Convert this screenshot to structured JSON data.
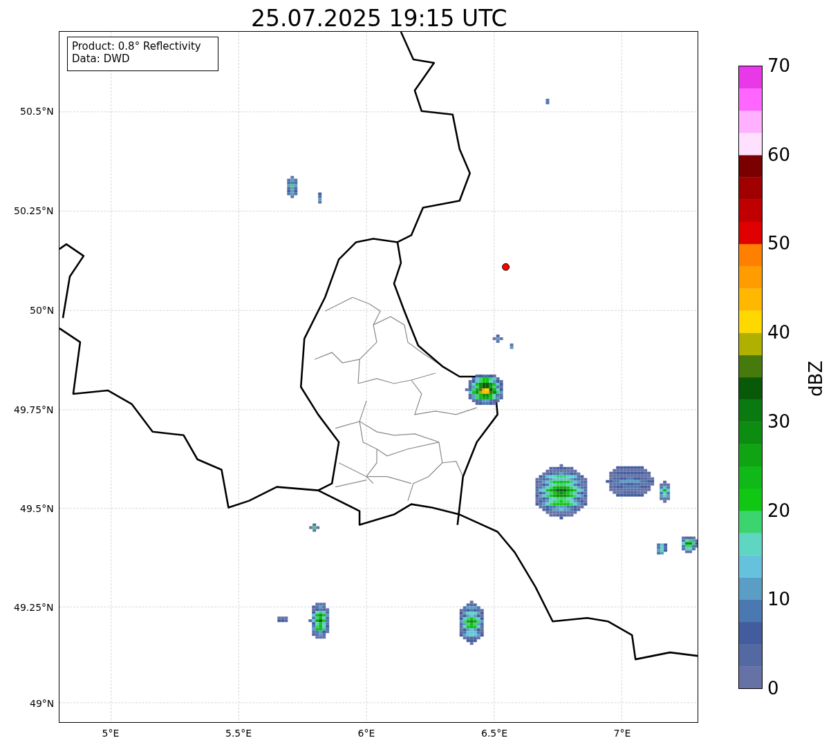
{
  "title": "25.07.2025 19:15 UTC",
  "info_box": [
    "Product: 0.8° Reflectivity",
    "Data: DWD"
  ],
  "map": {
    "y_ticks": [
      "50.5°N",
      "50.25°N",
      "50°N",
      "49.75°N",
      "49.5°N",
      "49.25°N",
      "49°N"
    ],
    "x_ticks": [
      "5°E",
      "5.5°E",
      "6°E",
      "6.5°E",
      "7°E"
    ]
  },
  "colorbar": {
    "label": "dBZ",
    "ticks": [
      "70",
      "60",
      "50",
      "40",
      "30",
      "20",
      "10",
      "0"
    ],
    "levels": [
      {
        "color": "#6672a6"
      },
      {
        "color": "#5468a2"
      },
      {
        "color": "#435c9e"
      },
      {
        "color": "#4a78b0"
      },
      {
        "color": "#5a9ec6"
      },
      {
        "color": "#66c2dc"
      },
      {
        "color": "#5ed6c2"
      },
      {
        "color": "#3cd46e"
      },
      {
        "color": "#10c814"
      },
      {
        "color": "#10b818"
      },
      {
        "color": "#10a414"
      },
      {
        "color": "#0c8c10"
      },
      {
        "color": "#0a7a10"
      },
      {
        "color": "#085a08"
      },
      {
        "color": "#467a0c"
      },
      {
        "color": "#b0b000"
      },
      {
        "color": "#ffd800"
      },
      {
        "color": "#ffb800"
      },
      {
        "color": "#ff9c00"
      },
      {
        "color": "#ff8000"
      },
      {
        "color": "#e00000"
      },
      {
        "color": "#c00000"
      },
      {
        "color": "#a00000"
      },
      {
        "color": "#7a0000"
      },
      {
        "color": "#ffe0ff"
      },
      {
        "color": "#ffb0ff"
      },
      {
        "color": "#ff66ff"
      },
      {
        "color": "#e838e8"
      }
    ]
  }
}
